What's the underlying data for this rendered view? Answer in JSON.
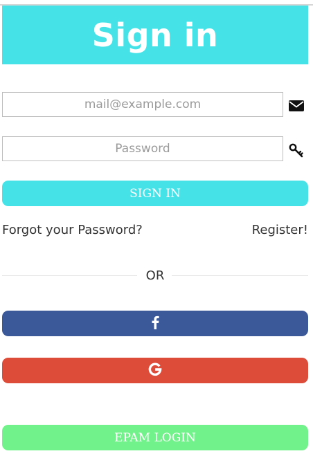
{
  "header": {
    "title": "Sign in"
  },
  "form": {
    "email_placeholder": "mail@example.com",
    "password_placeholder": "Password",
    "email_icon": "envelope-icon",
    "password_icon": "key-icon",
    "signin_label": "SIGN IN"
  },
  "links": {
    "forgot": "Forgot your Password?",
    "register": "Register!"
  },
  "divider": {
    "text": "OR"
  },
  "social": {
    "facebook_icon": "facebook-icon",
    "facebook_color": "#3b5998",
    "google_icon": "google-icon",
    "google_color": "#dd4b39"
  },
  "epam": {
    "label": "EPAM LOGIN",
    "color": "#72f28a"
  },
  "colors": {
    "accent": "#45e3e8"
  }
}
